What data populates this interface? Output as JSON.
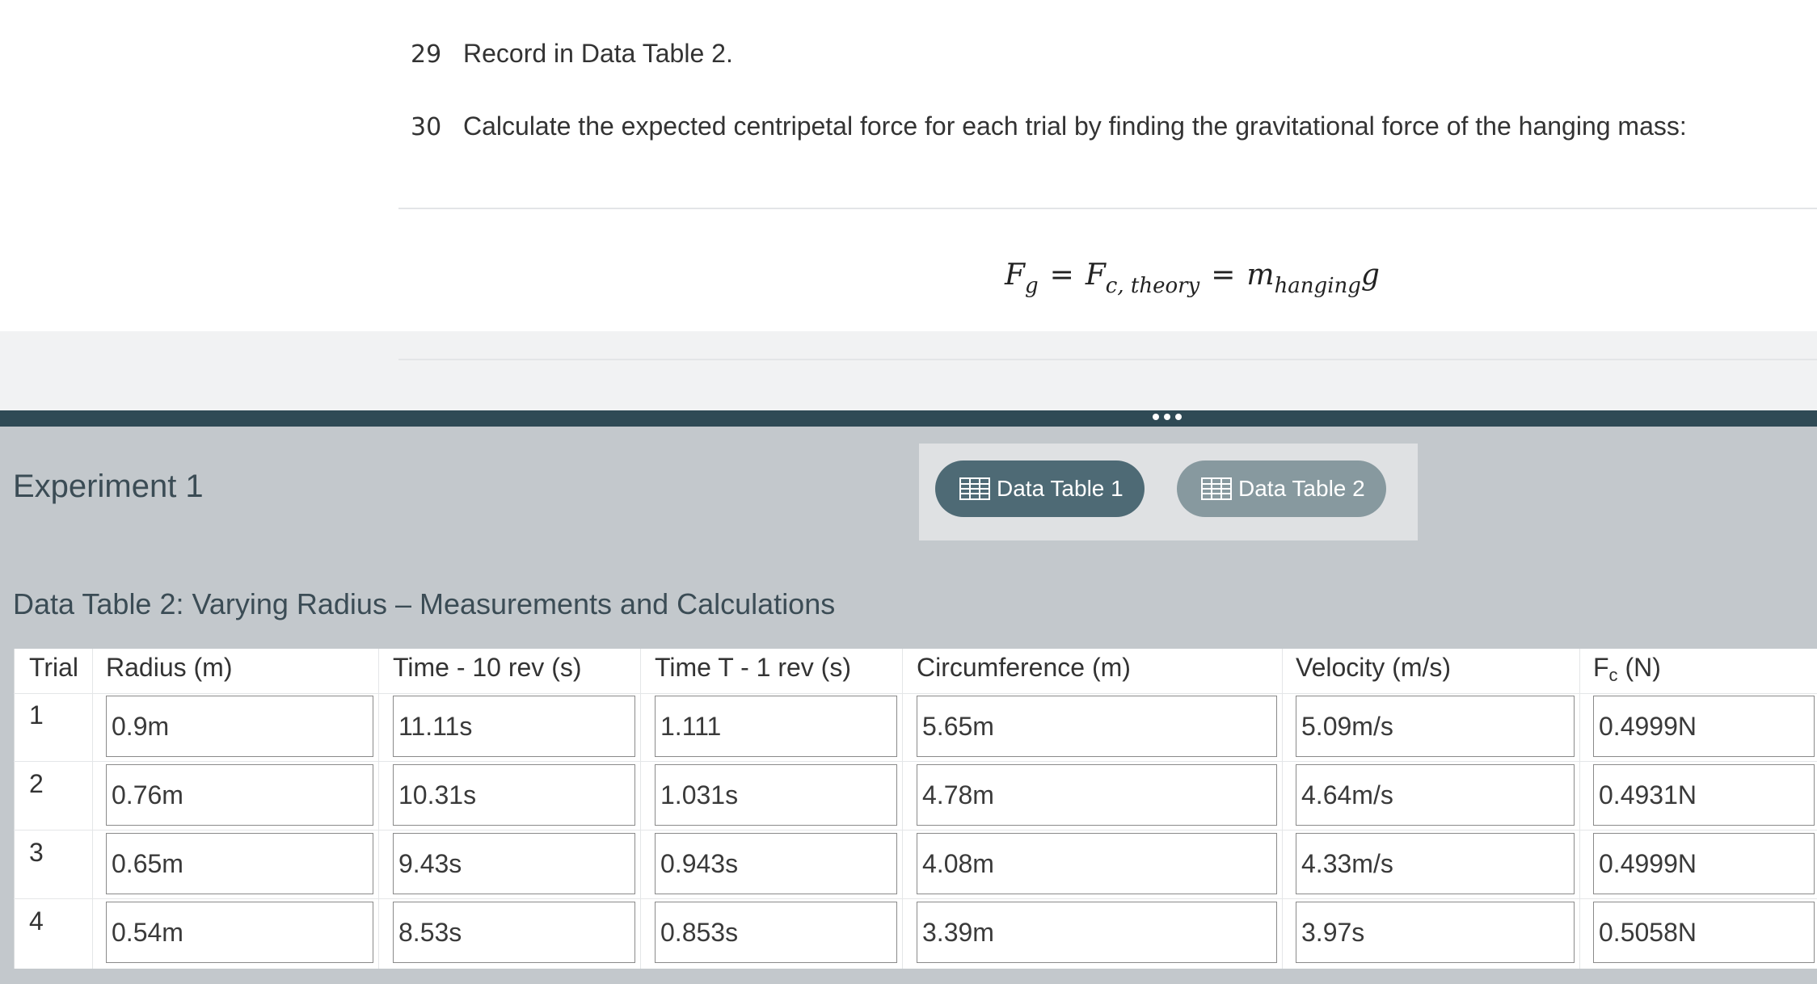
{
  "instructions": {
    "step29": {
      "number": "29",
      "text": "Record in Data Table 2."
    },
    "step30": {
      "number": "30",
      "text": "Calculate the expected centripetal force for each trial by finding the gravitational force of the hanging mass:"
    },
    "formula": {
      "f": "F",
      "g_sub": "g",
      "eq": "=",
      "fc": "F",
      "fc_sub": "c, theory",
      "m": "m",
      "m_sub": "hanging",
      "g": "g"
    }
  },
  "experiment": {
    "title": "Experiment 1"
  },
  "tabs": [
    {
      "label": "Data Table 1",
      "icon": "table-icon",
      "color": "#4e6a75"
    },
    {
      "label": "Data Table 2",
      "icon": "table-icon",
      "color": "#87999f"
    }
  ],
  "table": {
    "title": "Data Table 2: Varying Radius – Measurements and Calculations",
    "headers": {
      "trial": "Trial",
      "radius": "Radius (m)",
      "time10": "Time - 10 rev (s)",
      "time1": "Time T - 1 rev (s)",
      "circumference": "Circumference (m)",
      "velocity": "Velocity (m/s)",
      "force_main": "F",
      "force_sub": "c",
      "force_unit": " (N)"
    },
    "rows": [
      {
        "trial": "1",
        "radius": "0.9m",
        "time10": "11.11s",
        "time1": "1.111",
        "circumference": "5.65m",
        "velocity": "5.09m/s",
        "force": "0.4999N"
      },
      {
        "trial": "2",
        "radius": "0.76m",
        "time10": "10.31s",
        "time1": "1.031s",
        "circumference": "4.78m",
        "velocity": "4.64m/s",
        "force": "0.4931N"
      },
      {
        "trial": "3",
        "radius": "0.65m",
        "time10": "9.43s",
        "time1": "0.943s",
        "circumference": "4.08m",
        "velocity": "4.33m/s",
        "force": "0.4999N"
      },
      {
        "trial": "4",
        "radius": "0.54m",
        "time10": "8.53s",
        "time1": "0.853s",
        "circumference": "3.39m",
        "velocity": "3.97s",
        "force": "0.5058N"
      }
    ]
  },
  "colors": {
    "splitter": "#2f4a55",
    "panel": "#c3c8cc",
    "title_text": "#3b4c55"
  }
}
